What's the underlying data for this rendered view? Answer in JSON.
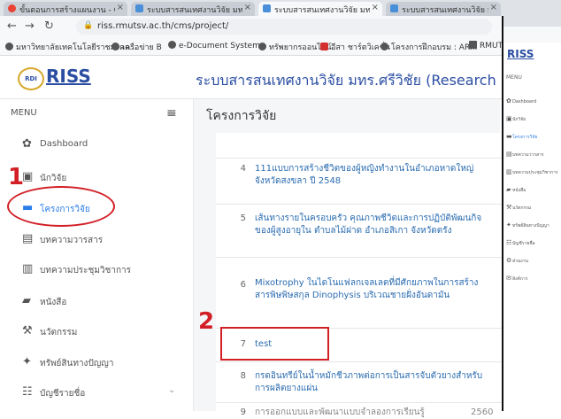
{
  "browser": {
    "tabs": [
      {
        "label": "ขั้นตอนการสร้างแผนงาน - Google"
      },
      {
        "label": "ระบบสารสนเทศงานวิจัย มทร.ศรีวิชัย"
      },
      {
        "label": "ระบบสารสนเทศงานวิจัย มทร.ศรีวิชัย"
      },
      {
        "label": "ระบบสารสนเทศงานวิจัย มทร.ศรีวิชัย"
      }
    ],
    "url": "riss.rmutsv.ac.th/cms/project/",
    "bookmarks": [
      "มหาวิทยาลัยเทคโนโลยีราชมงคล...",
      "เครือข่าย B",
      "e-Document System",
      "ทรัพยากรออนไลน์",
      "อีสา ชาร์ตวิเคชั่น",
      "โครงการฝึกอบรม : AR...",
      "RMUTNC"
    ]
  },
  "header": {
    "logo": "RISS",
    "logo_badge": "RDI",
    "title": "ระบบสารสนเทศงานวิจัย มทร.ศรีวิชัย (Research Info"
  },
  "sidebar": {
    "menu_label": "MENU",
    "items": [
      {
        "label": "Dashboard",
        "icon": "dashboard-icon"
      },
      {
        "label": "นักวิจัย",
        "icon": "researcher-icon"
      },
      {
        "label": "โครงการวิจัย",
        "icon": "project-icon"
      },
      {
        "label": "บทความวารสาร",
        "icon": "journal-icon"
      },
      {
        "label": "บทความประชุมวิชาการ",
        "icon": "conference-icon"
      },
      {
        "label": "หนังสือ",
        "icon": "book-icon"
      },
      {
        "label": "นวัตกรรม",
        "icon": "innovation-icon"
      },
      {
        "label": "ทรัพย์สินทางปัญญา",
        "icon": "ip-icon"
      },
      {
        "label": "บัญชีรายชื่อ",
        "icon": "directory-icon"
      }
    ]
  },
  "main": {
    "page_title": "โครงการวิจัย",
    "rows": [
      {
        "num": "4",
        "title": "111แบบการสร้างชีวิตของผู้หญิงทำงานในอำเภอหาดใหญ่ จังหวัดสงขลา ปี 2548"
      },
      {
        "num": "5",
        "title": "เส้นทางรายในครอบครัว คุณภาพชีวิตและการปฏิบัติพัฒนกิจของผู้สูงอายุใน ตำบลไม้ฝาด อำเภอสิเกา จังหวัดตรัง"
      },
      {
        "num": "6",
        "title": "Mixotrophy ในไดโนแฟลกเจลเลตที่มีศักยภาพในการสร้างสารพิษพิษสกุล Dinophysis บริเวณชายฝั่งอันดามัน"
      },
      {
        "num": "7",
        "title": "test"
      },
      {
        "num": "8",
        "title": "กรดอินทรีย์ในน้ำหมักชีวภาพต่อการเป็นสารจับตัวยางสำหรับการผลิตยางแผ่น"
      },
      {
        "num": "9",
        "title": "การออกแบบและพัฒนาแบบจำลองการเรียนรู้",
        "extra": "2560"
      }
    ]
  },
  "annotations": {
    "one": "1",
    "two": "2"
  },
  "overlay": {
    "logo": "RISS",
    "menu": "MENU",
    "items": [
      "Dashboard",
      "นักวิจัย",
      "โครงการวิจัย",
      "บทความวารสาร",
      "บทความประชุมวิชาการ",
      "หนังสือ",
      "นวัตกรรม",
      "ทรัพย์สินทางปัญญา",
      "บัญชีรายชื่อ",
      "ส่วนงาน",
      "ลิงค์การ"
    ]
  },
  "colors": {
    "accent": "#2b7de9",
    "brand": "#2b4ea3",
    "annotation": "#d21f26"
  }
}
